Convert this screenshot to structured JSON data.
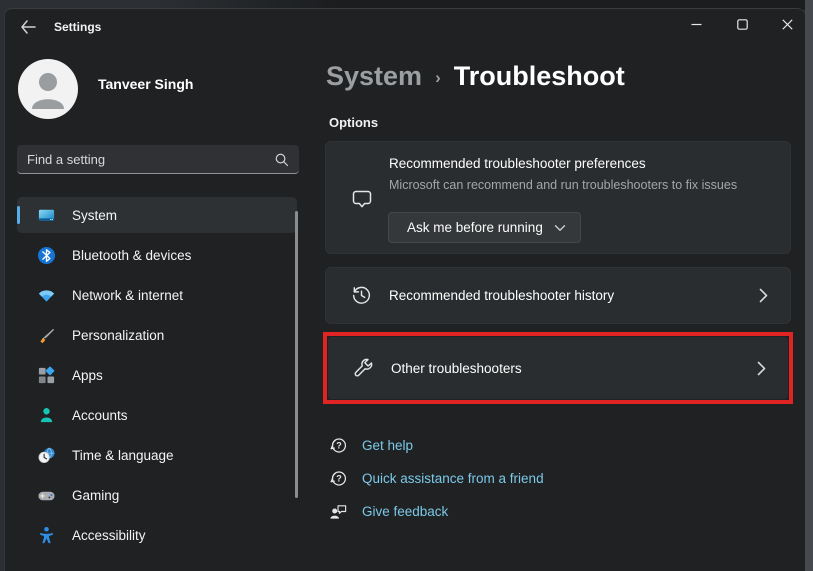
{
  "titlebar": {
    "title": "Settings"
  },
  "user": {
    "name": "Tanveer Singh"
  },
  "search": {
    "placeholder": "Find a setting"
  },
  "sidebar": {
    "items": [
      {
        "label": "System",
        "icon": "system-icon",
        "selected": true
      },
      {
        "label": "Bluetooth & devices",
        "icon": "bluetooth-icon",
        "selected": false
      },
      {
        "label": "Network & internet",
        "icon": "network-icon",
        "selected": false
      },
      {
        "label": "Personalization",
        "icon": "personalization-icon",
        "selected": false
      },
      {
        "label": "Apps",
        "icon": "apps-icon",
        "selected": false
      },
      {
        "label": "Accounts",
        "icon": "accounts-icon",
        "selected": false
      },
      {
        "label": "Time & language",
        "icon": "time-language-icon",
        "selected": false
      },
      {
        "label": "Gaming",
        "icon": "gaming-icon",
        "selected": false
      },
      {
        "label": "Accessibility",
        "icon": "accessibility-icon",
        "selected": false
      }
    ]
  },
  "main": {
    "breadcrumb": {
      "parent": "System",
      "separator": "›",
      "current": "Troubleshoot"
    },
    "section_label": "Options",
    "preferences_card": {
      "title": "Recommended troubleshooter preferences",
      "description": "Microsoft can recommend and run troubleshooters to fix issues",
      "dropdown_value": "Ask me before running",
      "icon": "feedback-bubble-icon"
    },
    "history_card": {
      "label": "Recommended troubleshooter history",
      "icon": "history-icon"
    },
    "other_card": {
      "label": "Other troubleshooters",
      "icon": "wrench-icon",
      "highlighted": true
    },
    "links": [
      {
        "label": "Get help",
        "icon": "help-chat-icon"
      },
      {
        "label": "Quick assistance from a friend",
        "icon": "help-chat-icon"
      },
      {
        "label": "Give feedback",
        "icon": "give-feedback-icon"
      }
    ]
  },
  "colors": {
    "accent": "#55aee6",
    "link": "#7cc9e8",
    "highlight": "#e02424",
    "window_bg": "#1f2123",
    "card_bg": "#2a2d2f"
  }
}
